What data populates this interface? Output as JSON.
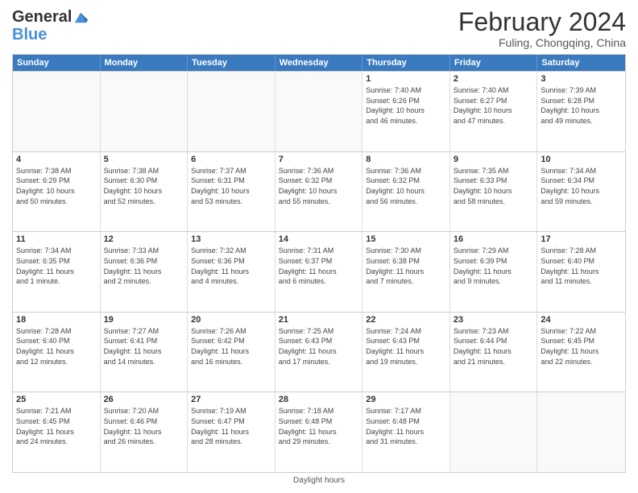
{
  "header": {
    "logo_line1": "General",
    "logo_line2": "Blue",
    "title": "February 2024",
    "subtitle": "Fuling, Chongqing, China"
  },
  "days_of_week": [
    "Sunday",
    "Monday",
    "Tuesday",
    "Wednesday",
    "Thursday",
    "Friday",
    "Saturday"
  ],
  "weeks": [
    [
      {
        "day": "",
        "info": ""
      },
      {
        "day": "",
        "info": ""
      },
      {
        "day": "",
        "info": ""
      },
      {
        "day": "",
        "info": ""
      },
      {
        "day": "1",
        "info": "Sunrise: 7:40 AM\nSunset: 6:26 PM\nDaylight: 10 hours\nand 46 minutes."
      },
      {
        "day": "2",
        "info": "Sunrise: 7:40 AM\nSunset: 6:27 PM\nDaylight: 10 hours\nand 47 minutes."
      },
      {
        "day": "3",
        "info": "Sunrise: 7:39 AM\nSunset: 6:28 PM\nDaylight: 10 hours\nand 49 minutes."
      }
    ],
    [
      {
        "day": "4",
        "info": "Sunrise: 7:38 AM\nSunset: 6:29 PM\nDaylight: 10 hours\nand 50 minutes."
      },
      {
        "day": "5",
        "info": "Sunrise: 7:38 AM\nSunset: 6:30 PM\nDaylight: 10 hours\nand 52 minutes."
      },
      {
        "day": "6",
        "info": "Sunrise: 7:37 AM\nSunset: 6:31 PM\nDaylight: 10 hours\nand 53 minutes."
      },
      {
        "day": "7",
        "info": "Sunrise: 7:36 AM\nSunset: 6:32 PM\nDaylight: 10 hours\nand 55 minutes."
      },
      {
        "day": "8",
        "info": "Sunrise: 7:36 AM\nSunset: 6:32 PM\nDaylight: 10 hours\nand 56 minutes."
      },
      {
        "day": "9",
        "info": "Sunrise: 7:35 AM\nSunset: 6:33 PM\nDaylight: 10 hours\nand 58 minutes."
      },
      {
        "day": "10",
        "info": "Sunrise: 7:34 AM\nSunset: 6:34 PM\nDaylight: 10 hours\nand 59 minutes."
      }
    ],
    [
      {
        "day": "11",
        "info": "Sunrise: 7:34 AM\nSunset: 6:35 PM\nDaylight: 11 hours\nand 1 minute."
      },
      {
        "day": "12",
        "info": "Sunrise: 7:33 AM\nSunset: 6:36 PM\nDaylight: 11 hours\nand 2 minutes."
      },
      {
        "day": "13",
        "info": "Sunrise: 7:32 AM\nSunset: 6:36 PM\nDaylight: 11 hours\nand 4 minutes."
      },
      {
        "day": "14",
        "info": "Sunrise: 7:31 AM\nSunset: 6:37 PM\nDaylight: 11 hours\nand 6 minutes."
      },
      {
        "day": "15",
        "info": "Sunrise: 7:30 AM\nSunset: 6:38 PM\nDaylight: 11 hours\nand 7 minutes."
      },
      {
        "day": "16",
        "info": "Sunrise: 7:29 AM\nSunset: 6:39 PM\nDaylight: 11 hours\nand 9 minutes."
      },
      {
        "day": "17",
        "info": "Sunrise: 7:28 AM\nSunset: 6:40 PM\nDaylight: 11 hours\nand 11 minutes."
      }
    ],
    [
      {
        "day": "18",
        "info": "Sunrise: 7:28 AM\nSunset: 6:40 PM\nDaylight: 11 hours\nand 12 minutes."
      },
      {
        "day": "19",
        "info": "Sunrise: 7:27 AM\nSunset: 6:41 PM\nDaylight: 11 hours\nand 14 minutes."
      },
      {
        "day": "20",
        "info": "Sunrise: 7:26 AM\nSunset: 6:42 PM\nDaylight: 11 hours\nand 16 minutes."
      },
      {
        "day": "21",
        "info": "Sunrise: 7:25 AM\nSunset: 6:43 PM\nDaylight: 11 hours\nand 17 minutes."
      },
      {
        "day": "22",
        "info": "Sunrise: 7:24 AM\nSunset: 6:43 PM\nDaylight: 11 hours\nand 19 minutes."
      },
      {
        "day": "23",
        "info": "Sunrise: 7:23 AM\nSunset: 6:44 PM\nDaylight: 11 hours\nand 21 minutes."
      },
      {
        "day": "24",
        "info": "Sunrise: 7:22 AM\nSunset: 6:45 PM\nDaylight: 11 hours\nand 22 minutes."
      }
    ],
    [
      {
        "day": "25",
        "info": "Sunrise: 7:21 AM\nSunset: 6:45 PM\nDaylight: 11 hours\nand 24 minutes."
      },
      {
        "day": "26",
        "info": "Sunrise: 7:20 AM\nSunset: 6:46 PM\nDaylight: 11 hours\nand 26 minutes."
      },
      {
        "day": "27",
        "info": "Sunrise: 7:19 AM\nSunset: 6:47 PM\nDaylight: 11 hours\nand 28 minutes."
      },
      {
        "day": "28",
        "info": "Sunrise: 7:18 AM\nSunset: 6:48 PM\nDaylight: 11 hours\nand 29 minutes."
      },
      {
        "day": "29",
        "info": "Sunrise: 7:17 AM\nSunset: 6:48 PM\nDaylight: 11 hours\nand 31 minutes."
      },
      {
        "day": "",
        "info": ""
      },
      {
        "day": "",
        "info": ""
      }
    ]
  ],
  "footer": "Daylight hours"
}
